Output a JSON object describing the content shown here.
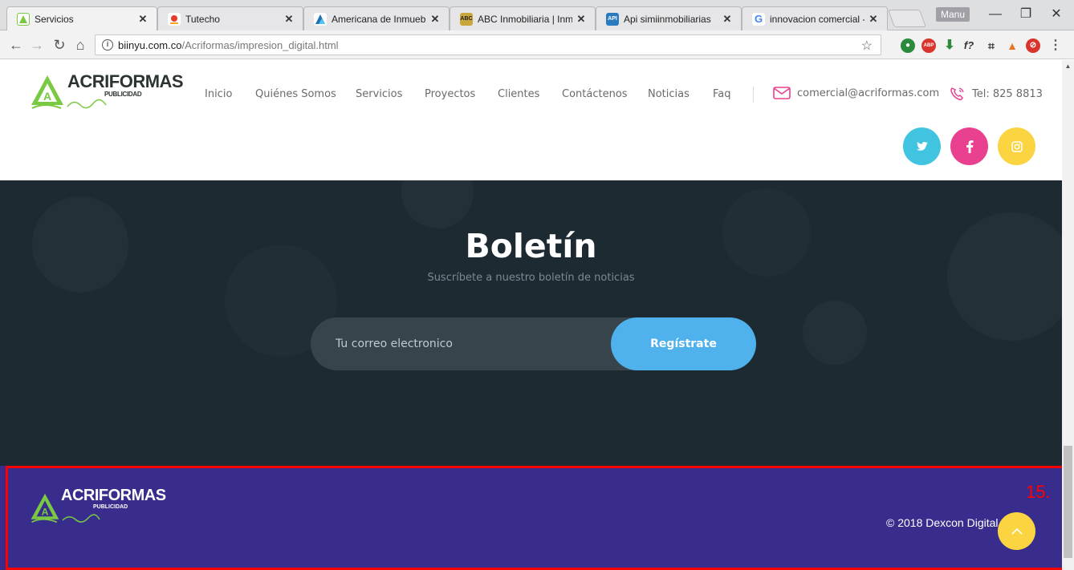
{
  "browser": {
    "tabs": [
      {
        "label": "Servicios",
        "favicon": "acriformas-logo-icon",
        "active": true
      },
      {
        "label": "Tutecho",
        "favicon": "tutecho-pin-icon",
        "active": false
      },
      {
        "label": "Americana de Inmueble",
        "favicon": "americana-logo-icon",
        "active": false
      },
      {
        "label": "ABC Inmobiliaria | Inmu",
        "favicon": "abc-logo-icon",
        "active": false
      },
      {
        "label": "Api simiinmobiliarias",
        "favicon": "api-logo-icon",
        "active": false
      },
      {
        "label": "innovacion comercial - ",
        "favicon": "google-icon",
        "active": false
      }
    ],
    "profile_label": "Manu",
    "url": {
      "host": "biinyu.com.co",
      "path": "/Acriformas/impresion_digital.html"
    },
    "favicon_texts": {
      "abc": "ABC",
      "api": "API",
      "google": "G"
    },
    "extension_labels": {
      "adblock": "ABP",
      "font": "f?"
    }
  },
  "header": {
    "logo": {
      "brand": "ACRIFORMAS",
      "sub": "PUBLICIDAD"
    },
    "nav": [
      "Inicio",
      "Quiénes Somos",
      "Servicios",
      "Proyectos",
      "Clientes",
      "Contáctenos",
      "Noticias",
      "Faq"
    ],
    "email": "comercial@acriformas.com",
    "phone": "Tel: 825 8813",
    "social": [
      {
        "name": "twitter",
        "color": "#40c4e0"
      },
      {
        "name": "facebook",
        "color": "#e9418f"
      },
      {
        "name": "instagram",
        "color": "#fbd441"
      }
    ]
  },
  "newsletter": {
    "title": "Boletín",
    "subtitle": "Suscríbete a nuestro boletín de noticias",
    "email_placeholder": "Tu correo electronico",
    "button_label": "Regístrate"
  },
  "footer": {
    "logo": {
      "brand": "ACRIFORMAS",
      "sub": "PUBLICIDAD"
    },
    "copyright": "© 2018 Dexcon Digital",
    "annotation_label": "15."
  },
  "colors": {
    "footer_bg": "#382c8c",
    "newsletter_bg": "#1d2a31",
    "button_blue": "#4fb2ec",
    "highlight_outline": "#ff0000",
    "brand_green": "#7ac943"
  }
}
